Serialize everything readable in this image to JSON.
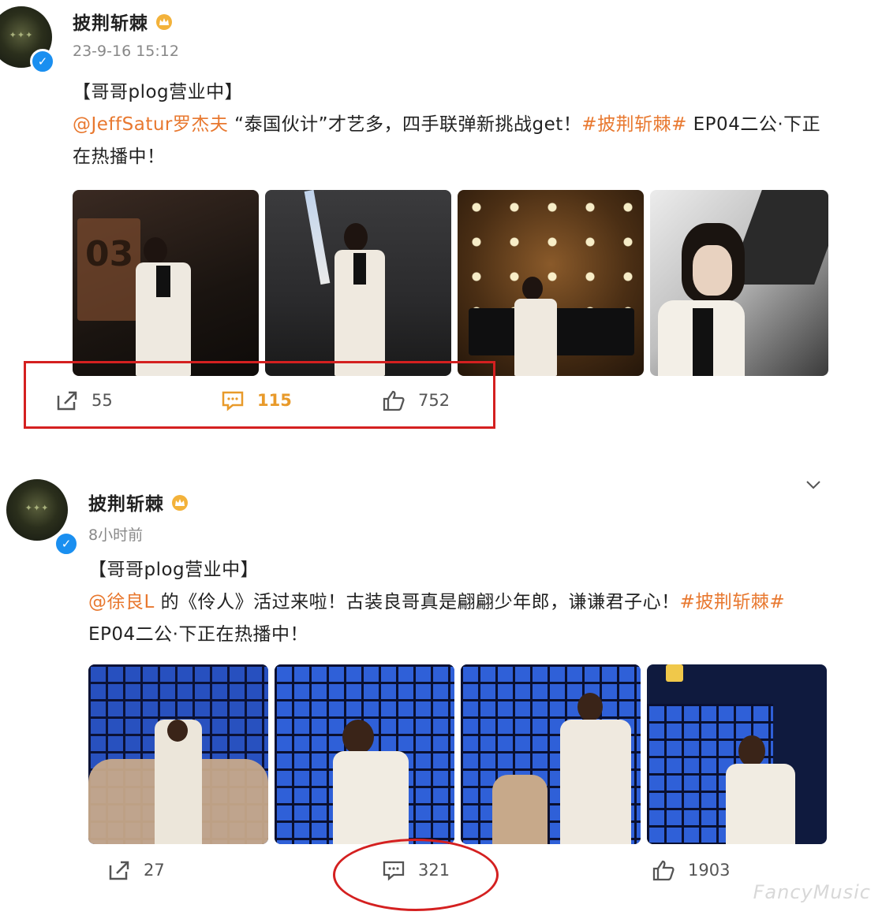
{
  "colors": {
    "accent": "#e8782f",
    "highlight": "#d42020",
    "verified": "#1a8ff0"
  },
  "posts": [
    {
      "username": "披荆斩棘",
      "time": "23-9-16 15:12",
      "header": "【哥哥plog营业中】",
      "mention": "@JeffSatur罗杰夫",
      "text1": " “泰国伙计”才艺多，四手联弹新挑战get！",
      "hashtag": "#披荆斩棘#",
      "text2": " EP04二公·下正在热播中！",
      "photos": [
        "photo-singer-white-suit",
        "photo-stage-spotlight",
        "photo-stage-lights",
        "photo-closeup-piano"
      ],
      "stats": {
        "share": "55",
        "comment": "115",
        "like": "752"
      }
    },
    {
      "username": "披荆斩棘",
      "time": "8小时前",
      "header": "【哥哥plog营业中】",
      "mention": "@徐良L",
      "text1": " 的《伶人》活过来啦！古装良哥真是翩翩少年郎，谦谦君子心！",
      "hashtag": "#披荆斩棘#",
      "text2": " EP04二公·下正在热播中！",
      "photos": [
        "photo-masked-dancers",
        "photo-singer-blue-grid",
        "photo-performers-grid",
        "photo-singer-closeup"
      ],
      "stats": {
        "share": "27",
        "comment": "321",
        "like": "1903"
      }
    }
  ],
  "avatar_text": "披荆斩棘",
  "watermark": "FancyMusic"
}
